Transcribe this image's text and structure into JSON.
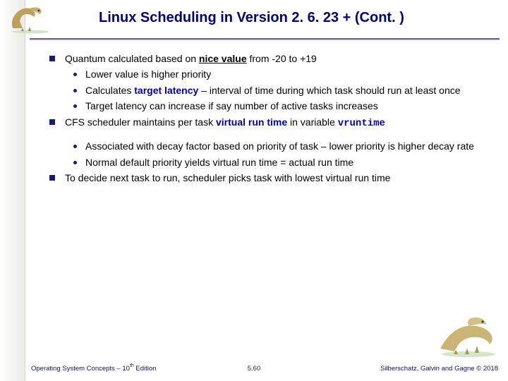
{
  "title": "Linux Scheduling in Version 2. 6. 23 + (Cont. )",
  "bullets": {
    "b1_pre": "Quantum calculated based on ",
    "b1_term": "nice value",
    "b1_post": " from -20 to +19",
    "b1a": "Lower value is higher priority",
    "b1b_pre": "Calculates ",
    "b1b_term": "target latency",
    "b1b_post": " – interval of time during which task should run at least once",
    "b1c": "Target latency can increase if say number of active tasks increases",
    "b2_pre": "CFS scheduler maintains per task ",
    "b2_term": "virtual run time",
    "b2_post": " in variable ",
    "b2_code": "vruntime",
    "b2a": "Associated with decay factor based on priority of task – lower priority is higher decay rate",
    "b2b": "Normal default priority yields virtual run time = actual run time",
    "b3": "To decide next task to run, scheduler picks task with lowest virtual run time"
  },
  "footer": {
    "left_pre": "Operating System Concepts – 10",
    "left_sup": "th",
    "left_post": " Edition",
    "center": "5.60",
    "right": "Silberschatz, Galvin and Gagne © 2018"
  },
  "icons": {
    "logo": "dinosaur-logo",
    "corner": "dinosaur-corner"
  }
}
